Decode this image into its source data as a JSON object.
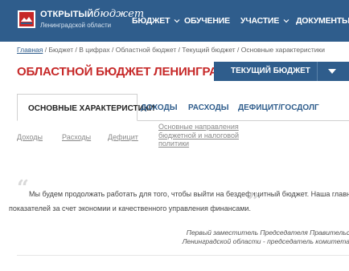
{
  "header": {
    "logo_title_prefix": "ОТКРЫТЫЙ",
    "logo_title_script": "бюджет",
    "logo_subtitle": "Ленинградской области",
    "logo_icon": "region-emblem-icon",
    "nav": [
      {
        "label": "БЮДЖЕТ",
        "has_dropdown": true
      },
      {
        "label": "ОБУЧЕНИЕ",
        "has_dropdown": false
      },
      {
        "label": "УЧАСТИЕ",
        "has_dropdown": true
      },
      {
        "label": "ДОКУМЕНТЫ",
        "has_dropdown": false
      }
    ],
    "background": "#2f5d8c"
  },
  "breadcrumb": {
    "home": "Главная",
    "rest": " / Бюджет / В цифрах / Областной бюджет / Текущий бюджет / Основные характеристики"
  },
  "page": {
    "title": "ОБЛАСТНОЙ БЮДЖЕТ ЛЕНИНГРАДСКОЙ ОБЛАСТИ",
    "title_color": "#c62828",
    "budget_select": {
      "value": "ТЕКУЩИЙ БЮДЖЕТ",
      "icon": "caret-down-icon"
    }
  },
  "tabs": [
    {
      "label": "ОСНОВНЫЕ ХАРАКТЕРИСТИКИ",
      "active": true
    },
    {
      "label": "ДОХОДЫ",
      "active": false
    },
    {
      "label": "РАСХОДЫ",
      "active": false
    },
    {
      "label": "ДЕФИЦИТ/ГОСДОЛГ",
      "active": false
    }
  ],
  "sublinks": [
    {
      "label": "Доходы"
    },
    {
      "label": "Расходы"
    },
    {
      "label": "Дефицит"
    },
    {
      "lines": [
        "Основные направления",
        "бюджетной и налоговой",
        "политики"
      ]
    }
  ],
  "quote": {
    "line1": "Мы будем продолжать работать для того, чтобы выйти на бездефицитный бюджет. Наша главная",
    "line2": "показателей за счет экономии и качественного управления финансами.",
    "open_mark": "“",
    "close_mark": "”",
    "author_line1": "Первый заместитель Председателя Правительс",
    "author_line2": "Ленинградской области - председатель комитета"
  }
}
